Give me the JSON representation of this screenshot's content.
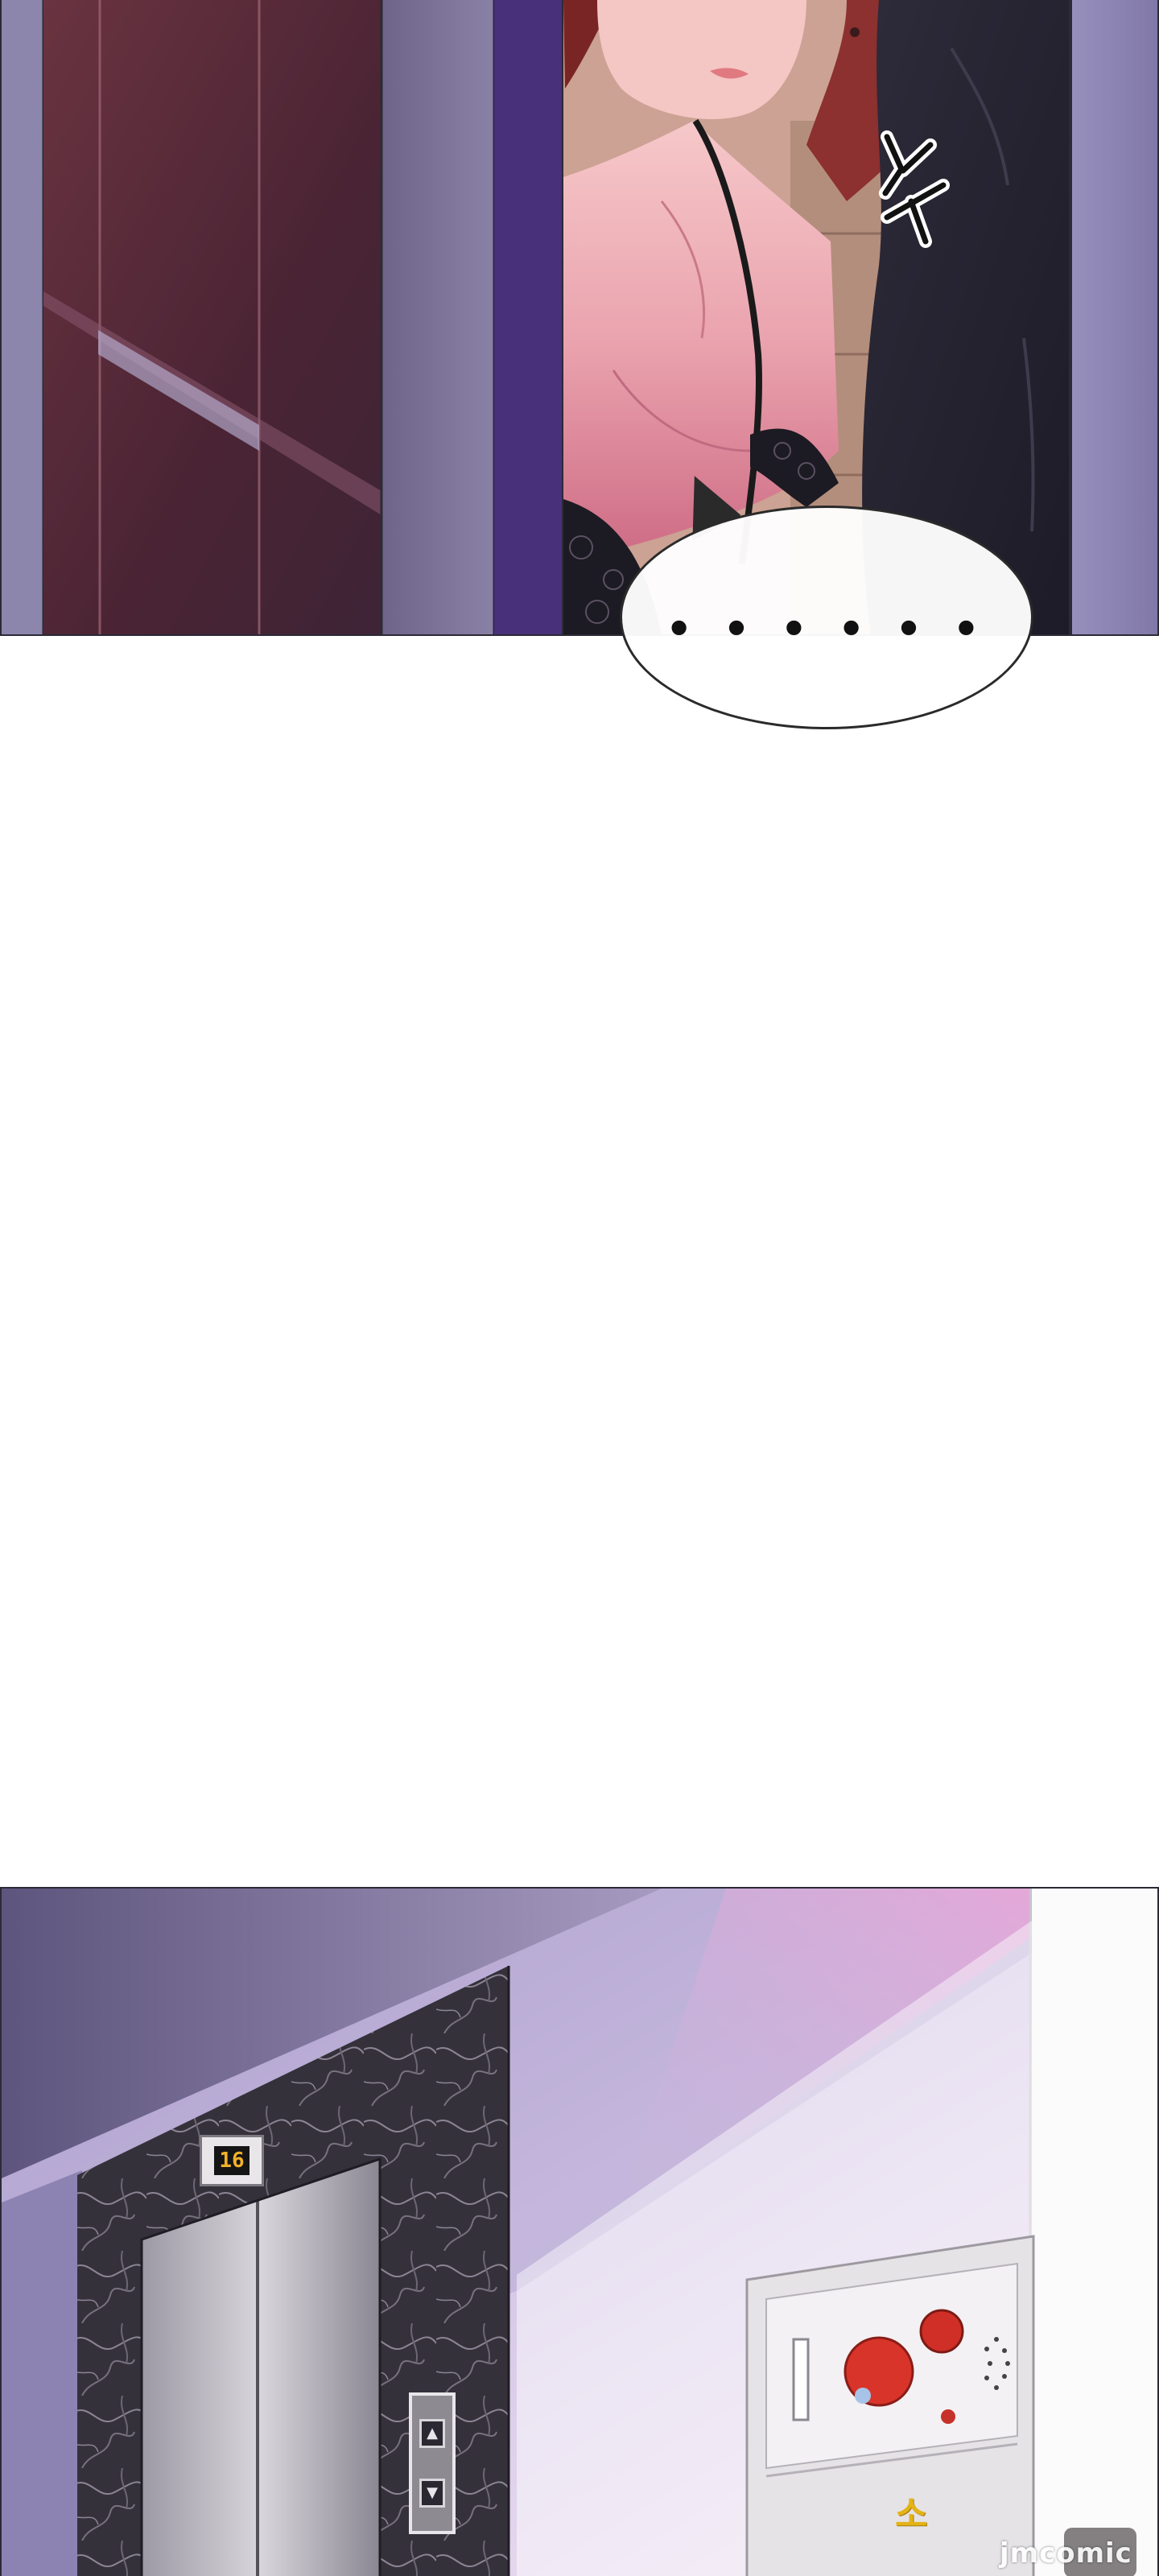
{
  "top_panel": {
    "speech_bubble": {
      "text": "• • • • • •"
    },
    "sound_effect": {
      "text": "스윽"
    }
  },
  "bottom_panel": {
    "elevator": {
      "floor_indicator": "16",
      "call_buttons": [
        "▲",
        "▼"
      ]
    },
    "hydrant_cabinet": {
      "label": "소"
    }
  },
  "watermark": {
    "text": "jmcomic"
  },
  "colors": {
    "hall_wall": "#8d85ad",
    "corridor_dark": "#5d2e3a",
    "skin": "#f3b9bd",
    "jacket": "#262432",
    "marble": "#3a3640",
    "alarm_red": "#d8342a"
  }
}
